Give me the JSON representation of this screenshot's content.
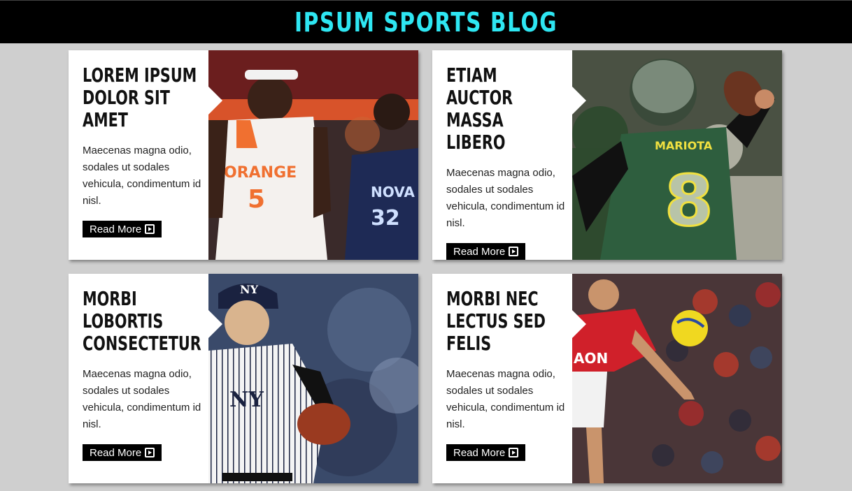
{
  "header": {
    "title": "IPSUM SPORTS BLOG"
  },
  "colors": {
    "accent": "#2ee6f2",
    "header_bg": "#000000",
    "page_bg": "#cfcfcf"
  },
  "cards": [
    {
      "title": "LOREM IPSUM DOLOR SIT AMET",
      "body": "Maecenas magna odio, sodales ut sodales vehicula, condimentum id nisl.",
      "link": "Read More",
      "photo_alt": "basketball players"
    },
    {
      "title": "ETIAM AUCTOR MASSA LIBERO",
      "body": "Maecenas magna odio, sodales ut sodales vehicula, condimentum id nisl.",
      "link": "Read More",
      "photo_alt": "football quarterback"
    },
    {
      "title": "MORBI LOBORTIS CONSECTETUR",
      "body": "Maecenas magna odio, sodales ut sodales vehicula, condimentum id nisl.",
      "link": "Read More",
      "photo_alt": "baseball pitcher"
    },
    {
      "title": "MORBI NEC LECTUS SED FELIS",
      "body": "Maecenas magna odio, sodales ut sodales vehicula, condimentum id nisl.",
      "link": "Read More",
      "photo_alt": "soccer player"
    }
  ]
}
